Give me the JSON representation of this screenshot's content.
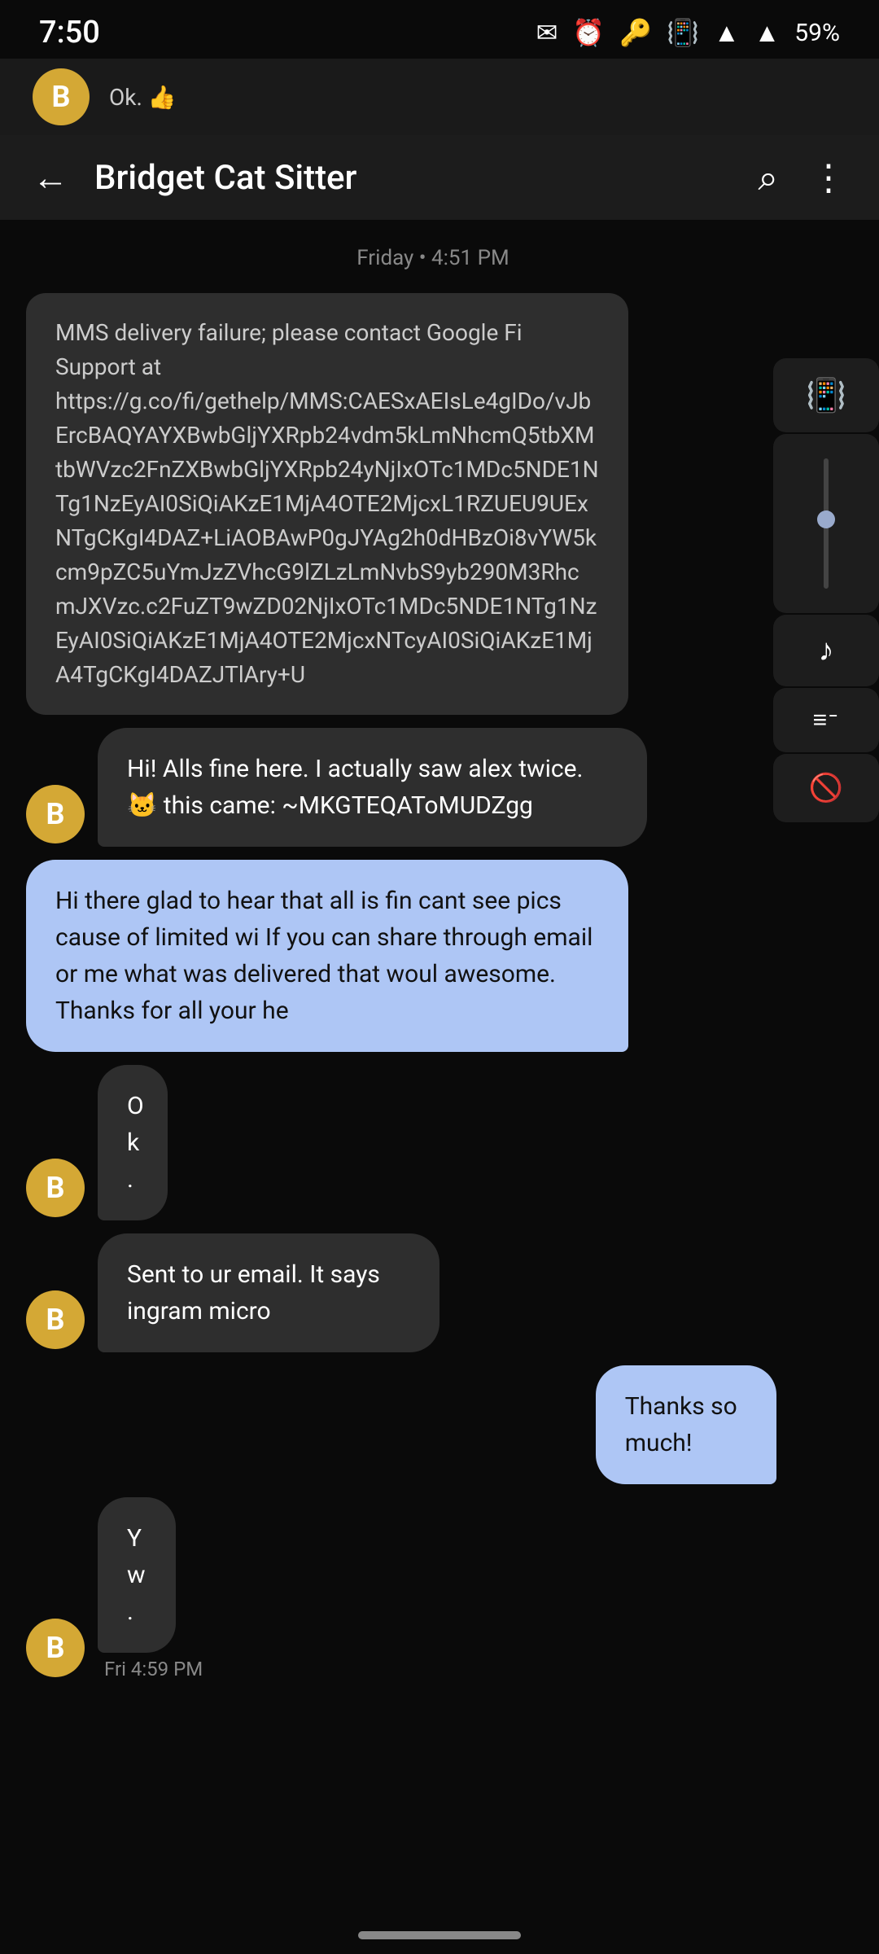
{
  "statusBar": {
    "time": "7:50",
    "battery": "59%"
  },
  "prevChat": {
    "avatarLetter": "B",
    "previewText": "Ok. 👍"
  },
  "toolbar": {
    "title": "Bridget Cat Sitter",
    "backLabel": "←",
    "searchLabel": "⌕",
    "moreLabel": "⋮"
  },
  "chat": {
    "datestamp": "Friday • 4:51 PM",
    "messages": [
      {
        "id": "msg1",
        "type": "system",
        "text": "MMS delivery failure; please contact Google Fi Support at https://g.co/fi/gethelp/MMS:CAESxAEIsLe4gIDo/vJbErcBAQYAYXBwbGljYXRpb24vdm5kLmNhcmQ5tbXMtbWVzc2FnZXBwbGljYXRpb24yNjIxOTc1MDc5NDE1NTg1NzEyAI0SiQiAKzE1MjA4OTE2MjcxL1RZUEU9UExNTgCKgI4DAZ+LiAOBAwP0gJYAg2h0dHBzOi8vYW5kcm9pZC5uYmJzZVhcG9lZLzLmNvbS9yb290M3RhcmJXVzc.c2FnZT9wZD02NjIxOTc1MDc5NDE1NTg1NzEyAI0SiQiAKzE1MjA4OTE2MjcxNTcyAI0SiQiAKzE1MjA4TgCKgI4DAZJTlAry+U"
      },
      {
        "id": "msg2",
        "type": "incoming",
        "avatarLetter": "B",
        "text": "Hi! Alls fine here. I actually saw alex twice. 🐱  this came: ~MKGTEQAToMUDZgg"
      },
      {
        "id": "msg3",
        "type": "outgoing",
        "text": "Hi there glad to hear that all is fin cant see pics cause of limited wi If you can share through email or me what was delivered that woul awesome. Thanks for all your he"
      },
      {
        "id": "msg4",
        "type": "incoming",
        "avatarLetter": "B",
        "text": "Ok."
      },
      {
        "id": "msg5",
        "type": "incoming",
        "avatarLetter": "B",
        "text": "Sent to ur email. It says ingram micro"
      },
      {
        "id": "msg6",
        "type": "outgoing",
        "text": "Thanks so much!"
      },
      {
        "id": "msg7",
        "type": "incoming",
        "avatarLetter": "B",
        "text": "Yw.",
        "time": "Fri 4:59 PM"
      }
    ]
  },
  "overlay": {
    "vibrateIcon": "📳",
    "musicIcon": "♪",
    "eqIcon": "≡≡",
    "subtitleIcon": "⊡"
  }
}
